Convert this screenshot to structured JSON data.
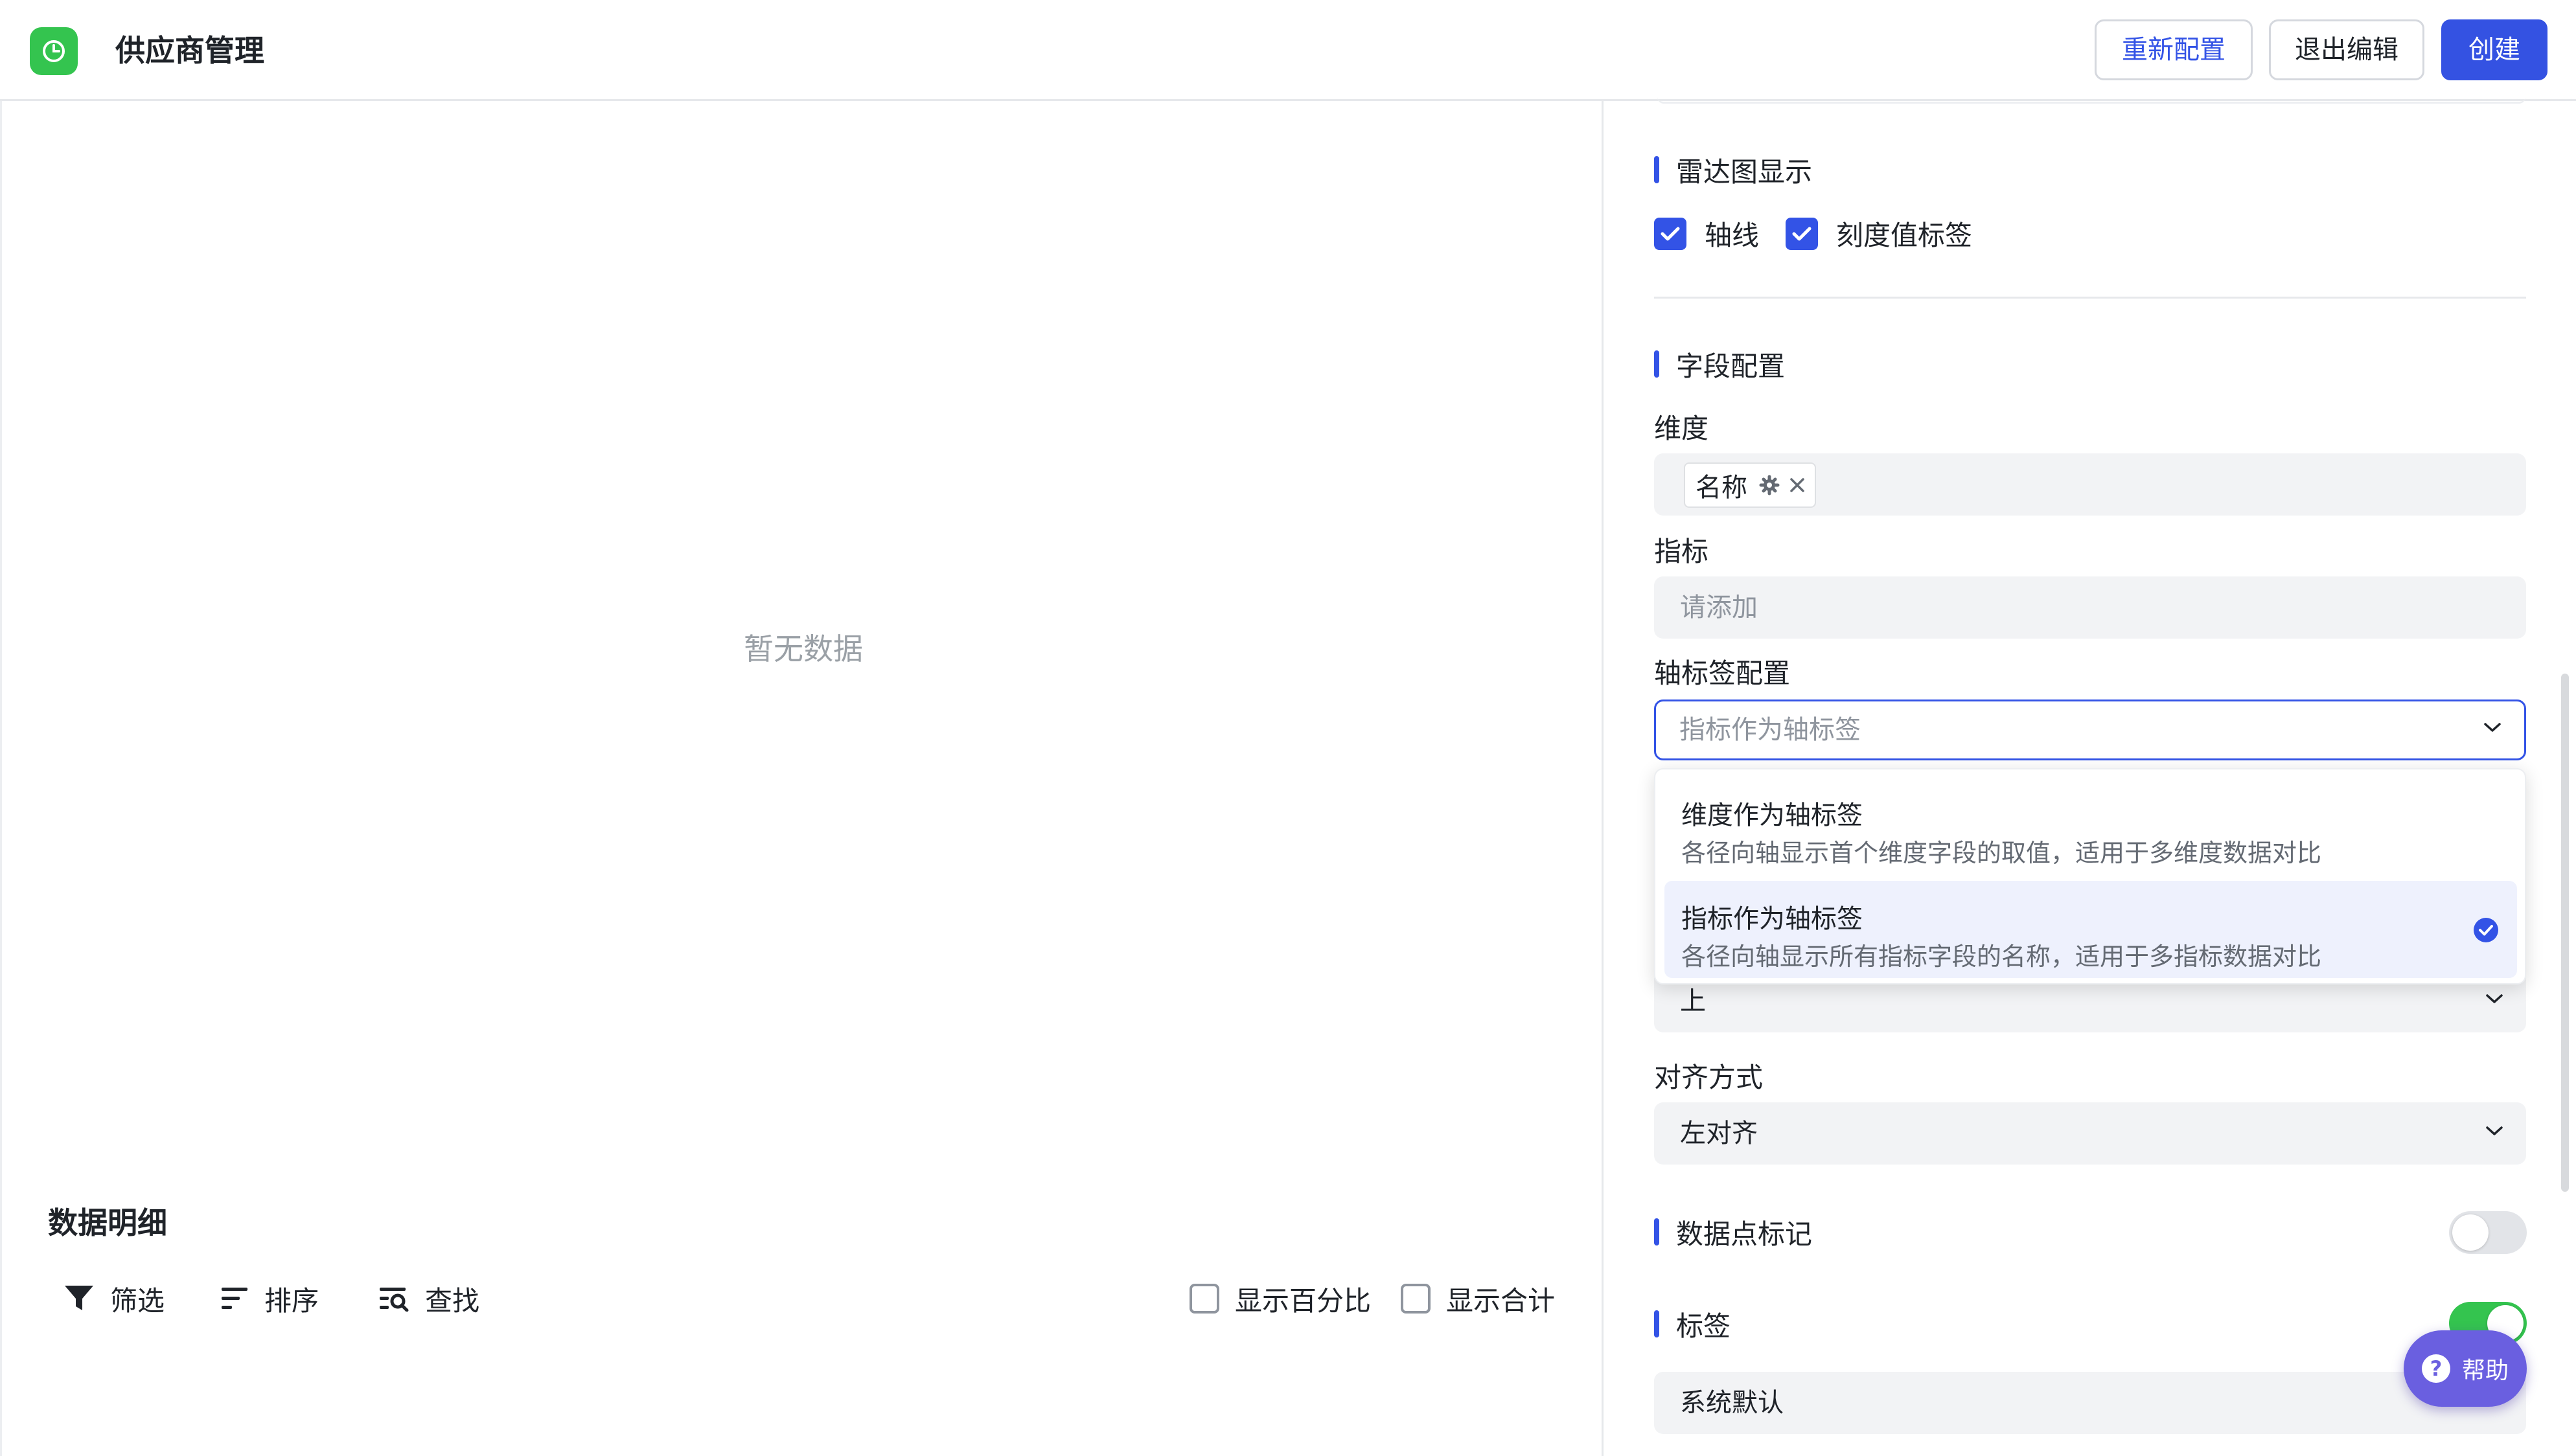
{
  "header": {
    "app_title": "供应商管理",
    "reconfig_label": "重新配置",
    "exit_edit_label": "退出编辑",
    "create_label": "创建"
  },
  "preview": {
    "empty_text": "暂无数据",
    "detail_title": "数据明细",
    "tools": {
      "filter": "筛选",
      "sort": "排序",
      "find": "查找"
    },
    "show_percent": "显示百分比",
    "show_total": "显示合计"
  },
  "config": {
    "radar_section": "雷达图显示",
    "axis_line": "轴线",
    "axis_line_checked": true,
    "tick_label": "刻度值标签",
    "tick_label_checked": true,
    "field_section": "字段配置",
    "dimension_label": "维度",
    "dimension_tag": "名称",
    "metric_label": "指标",
    "metric_placeholder": "请添加",
    "axis_label_config": "轴标签配置",
    "axis_label_value": "指标作为轴标签",
    "axis_label_options": [
      {
        "title": "维度作为轴标签",
        "desc": "各径向轴显示首个维度字段的取值，适用于多维度数据对比",
        "selected": false
      },
      {
        "title": "指标作为轴标签",
        "desc": "各径向轴显示所有指标字段的名称，适用于多指标数据对比",
        "selected": true
      }
    ],
    "position_value": "上",
    "align_label": "对齐方式",
    "align_value": "左对齐",
    "data_point_section": "数据点标记",
    "data_point_on": false,
    "tag_section": "标签",
    "tag_on": true,
    "tag_style_value": "系统默认"
  },
  "help": {
    "label": "帮助"
  },
  "colors": {
    "accent": "#3353e6",
    "brand_green": "#34c44f",
    "help_purple": "#6a5fe0"
  },
  "icons": [
    "app-logo-icon",
    "filter-icon",
    "sort-icon",
    "find-icon",
    "gear-icon",
    "close-icon",
    "chevron-down-icon",
    "check-circle-icon",
    "help-icon"
  ]
}
